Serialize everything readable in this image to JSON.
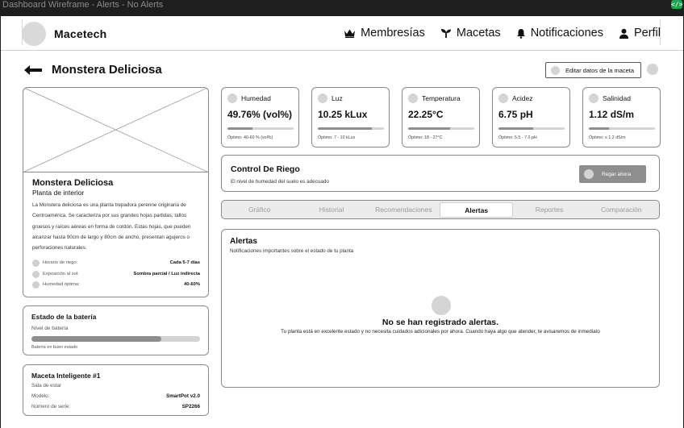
{
  "window": {
    "title": "Dashboard Wireframe - Alerts - No Alerts",
    "corner_icon": "code-icon"
  },
  "header": {
    "brand": "Macetech",
    "nav": [
      {
        "label": "Membresías",
        "icon": "crown-icon"
      },
      {
        "label": "Macetas",
        "icon": "sprout-icon"
      },
      {
        "label": "Notificaciones",
        "icon": "bell-icon"
      },
      {
        "label": "Perfil",
        "icon": "user-icon"
      }
    ]
  },
  "page": {
    "title": "Monstera Deliciosa",
    "edit_button": "Editar datos de la maceta"
  },
  "plant": {
    "name": "Monstera Deliciosa",
    "type": "Planta de interior",
    "description": "La Monstera deliciosa es una planta trepadora perenne originaria de Centroamérica. Se caracteriza por sus grandes hojas partidas, tallos gruesos y raíces aéreas en forma de cordón. Estas hojas, que pueden alcanzar hasta 90cm de largo y 80cm de ancho, presentan agujeros o perforaciones naturales.",
    "props": [
      {
        "label": "Horario de riego:",
        "value": "Cada 5-7 días"
      },
      {
        "label": "Exposición al sol:",
        "value": "Sombra parcial / Luz indirecta"
      },
      {
        "label": "Humedad óptima:",
        "value": "40-60%"
      }
    ]
  },
  "battery": {
    "title": "Estado de la batería",
    "label": "Nivel de batería",
    "level": 0.77,
    "status": "Batería en buen estado"
  },
  "pot": {
    "title": "Maceta Inteligente #1",
    "room": "Sala de estar",
    "rows": [
      {
        "label": "Modelo:",
        "value": "SmartPot v2.0"
      },
      {
        "label": "Número de serie:",
        "value": "SP2266"
      }
    ]
  },
  "metrics": [
    {
      "name": "Humedad",
      "value": "49.76% (vol%)",
      "level": 0.38,
      "optimal": "Óptimo: 40-60 % (vol%)"
    },
    {
      "name": "Luz",
      "value": "10.25 kLux",
      "level": 0.82,
      "optimal": "Óptimo: 7 - 10 kLux"
    },
    {
      "name": "Temperatura",
      "value": "22.25°C",
      "level": 0.64,
      "optimal": "Óptimo: 18 - 27°C"
    },
    {
      "name": "Acidez",
      "value": "6.75 pH",
      "level": 0.52,
      "optimal": "Óptimo: 5.5 - 7.0 pH"
    },
    {
      "name": "Salinidad",
      "value": "1.12 dS/m",
      "level": 0.3,
      "optimal": "Óptimo: ≤ 1.2 dS/m"
    }
  ],
  "irrigation": {
    "title": "Control De Riego",
    "subtitle": "El nivel de humedad del suelo es adecuado",
    "button": "Regar ahora"
  },
  "tabs": [
    {
      "label": "Gráfico",
      "active": false
    },
    {
      "label": "Historial",
      "active": false
    },
    {
      "label": "Recomendaciones",
      "active": false
    },
    {
      "label": "Alertas",
      "active": true
    },
    {
      "label": "Reportes",
      "active": false
    },
    {
      "label": "Comparación",
      "active": false
    }
  ],
  "alerts": {
    "title": "Alertas",
    "subtitle": "Notificaciones importantes sobre el estado de tu planta",
    "empty_title": "No se han registrado alertas.",
    "empty_message": "Tu planta está en excelente estado y no necesita cuidados adicionales por ahora. Cuando haya algo que atender, te avisaremos de inmediato"
  }
}
